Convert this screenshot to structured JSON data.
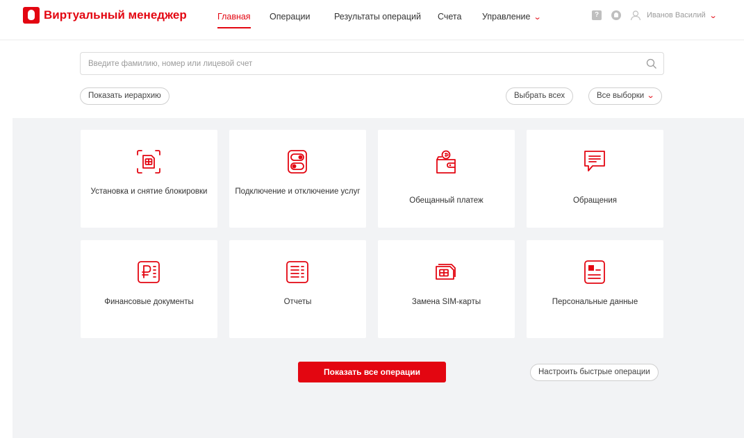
{
  "header": {
    "logo_text": "Виртуальный менеджер",
    "nav": [
      {
        "label": "Главная",
        "active": true
      },
      {
        "label": "Операции",
        "active": false
      },
      {
        "label": "Результаты операций",
        "active": false
      },
      {
        "label": "Счета",
        "active": false
      },
      {
        "label": "Управление",
        "active": false,
        "has_dropdown": true
      }
    ],
    "help_label": "?",
    "user_name": "Иванов Василий"
  },
  "search": {
    "placeholder": "Введите фамилию, номер или лицевой счет",
    "value": ""
  },
  "toolbar": {
    "show_hierarchy": "Показать иерархию",
    "select_all": "Выбрать всех",
    "all_selections": "Все выборки"
  },
  "operations": [
    {
      "label": "Установка и снятие блокировки",
      "icon": "sim-scan-icon"
    },
    {
      "label": "Подключение и отключение услуг",
      "icon": "toggle-switches-icon"
    },
    {
      "label": "Обещанный платеж",
      "icon": "wallet-icon"
    },
    {
      "label": "Обращения",
      "icon": "message-icon"
    },
    {
      "label": "Финансовые документы",
      "icon": "ruble-document-icon"
    },
    {
      "label": "Отчеты",
      "icon": "report-icon"
    },
    {
      "label": "Замена SIM-карты",
      "icon": "sim-swap-icon"
    },
    {
      "label": "Персональные данные",
      "icon": "personal-card-icon"
    }
  ],
  "footer": {
    "show_all": "Показать все операции",
    "configure": "Настроить быстрые операции"
  },
  "colors": {
    "accent": "#e30611",
    "background": "#f2f3f5",
    "muted_icon": "#bfbfbf"
  }
}
